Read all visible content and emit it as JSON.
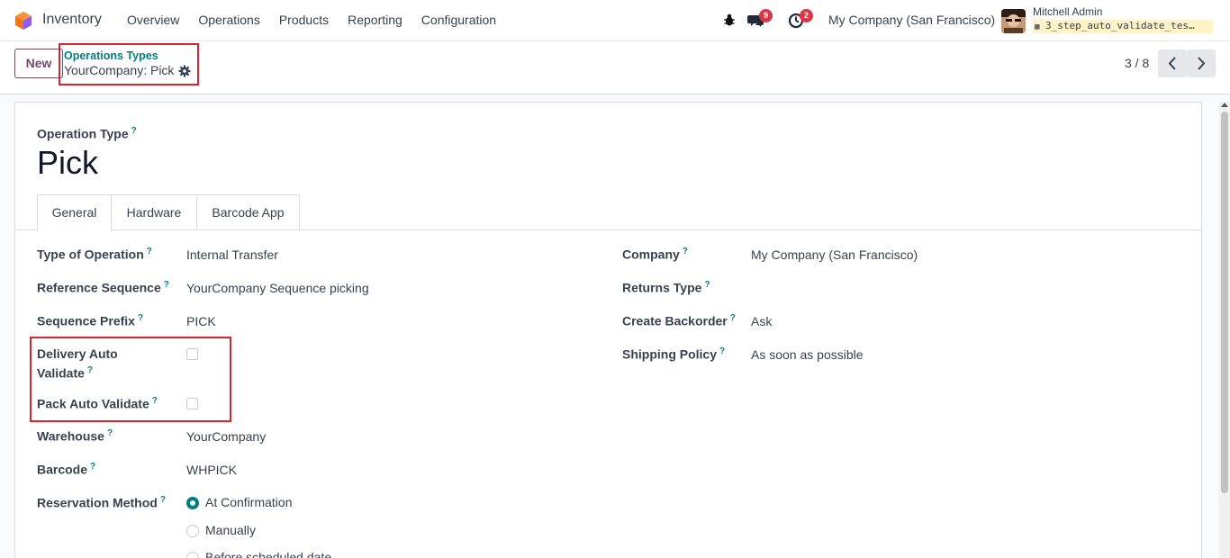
{
  "navbar": {
    "app_name": "Inventory",
    "menu": [
      "Overview",
      "Operations",
      "Products",
      "Reporting",
      "Configuration"
    ],
    "messages_count": "9",
    "activities_count": "2",
    "company": "My Company (San Francisco)",
    "user_name": "Mitchell Admin",
    "database": "3_step_auto_validate_tes…"
  },
  "control": {
    "new_label": "New",
    "breadcrumb_parent": "Operations Types",
    "breadcrumb_current": "YourCompany: Pick",
    "pager": "3 / 8"
  },
  "form": {
    "type_label": "Operation Type",
    "title": "Pick",
    "tabs": [
      "General",
      "Hardware",
      "Barcode App"
    ],
    "help_mark": "?",
    "left_fields": {
      "type_of_operation": {
        "label": "Type of Operation",
        "value": "Internal Transfer"
      },
      "reference_sequence": {
        "label": "Reference Sequence",
        "value": "YourCompany Sequence picking"
      },
      "sequence_prefix": {
        "label": "Sequence Prefix",
        "value": "PICK"
      },
      "delivery_auto_validate": {
        "label_line1": "Delivery Auto",
        "label_line2": "Validate",
        "checked": false
      },
      "pack_auto_validate": {
        "label": "Pack Auto Validate",
        "checked": false
      },
      "warehouse": {
        "label": "Warehouse",
        "value": "YourCompany"
      },
      "barcode": {
        "label": "Barcode",
        "value": "WHPICK"
      },
      "reservation_method": {
        "label": "Reservation Method",
        "options": [
          "At Confirmation",
          "Manually",
          "Before scheduled date"
        ],
        "selected": "At Confirmation"
      }
    },
    "right_fields": {
      "company": {
        "label": "Company",
        "value": "My Company (San Francisco)"
      },
      "returns_type": {
        "label": "Returns Type",
        "value": ""
      },
      "create_backorder": {
        "label": "Create Backorder",
        "value": "Ask"
      },
      "shipping_policy": {
        "label": "Shipping Policy",
        "value": "As soon as possible"
      }
    }
  },
  "colors": {
    "accent": "#017e84",
    "brand": "#714b67",
    "highlight": "#d9232e"
  }
}
